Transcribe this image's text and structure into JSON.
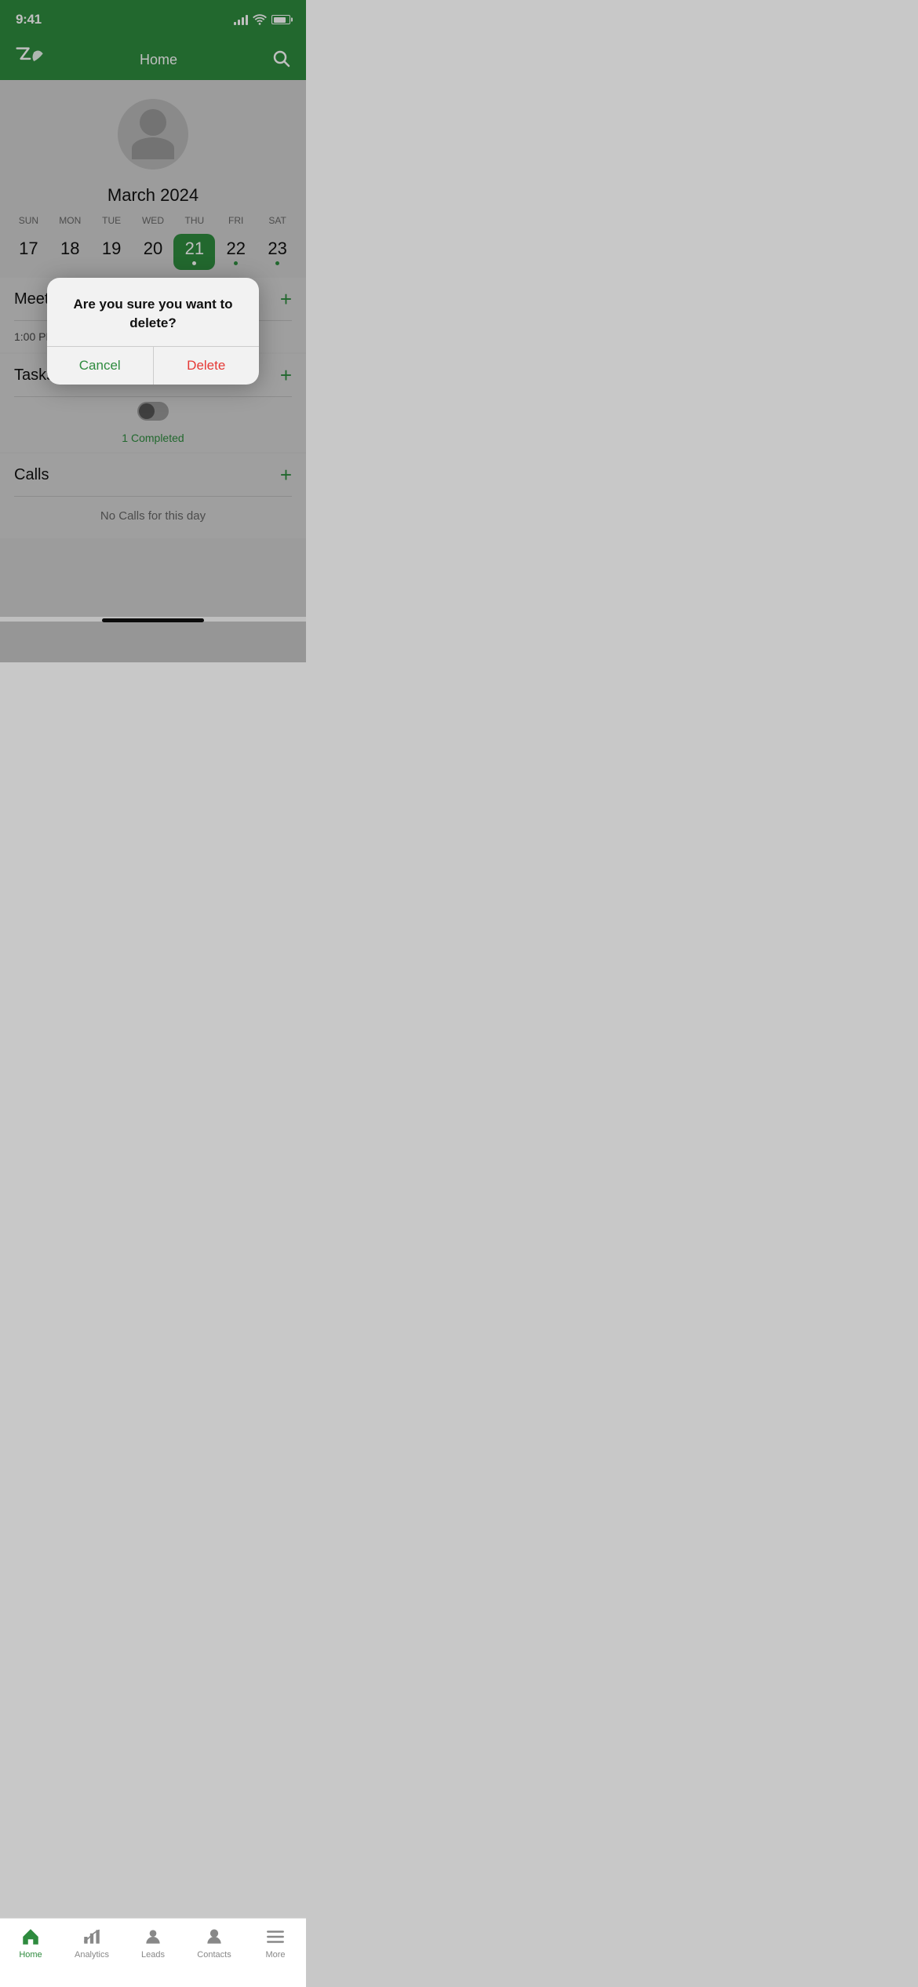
{
  "statusBar": {
    "time": "9:41"
  },
  "navBar": {
    "title": "Home",
    "logoText": "Z∧",
    "searchLabel": "search"
  },
  "profile": {
    "avatarAlt": "User Avatar"
  },
  "calendar": {
    "monthYear": "March 2024",
    "weekdays": [
      "SUN",
      "MON",
      "TUE",
      "WED",
      "THU",
      "FRI",
      "SAT"
    ],
    "days": [
      {
        "date": 17,
        "hasEvent": false,
        "today": false
      },
      {
        "date": 18,
        "hasEvent": false,
        "today": false
      },
      {
        "date": 19,
        "hasEvent": false,
        "today": false
      },
      {
        "date": 20,
        "hasEvent": false,
        "today": false
      },
      {
        "date": 21,
        "hasEvent": true,
        "today": true
      },
      {
        "date": 22,
        "hasEvent": true,
        "today": false
      },
      {
        "date": 23,
        "hasEvent": true,
        "today": false
      }
    ]
  },
  "meetings": {
    "title": "Meetings",
    "addLabel": "+",
    "item": {
      "time": "1:00 PM"
    }
  },
  "tasks": {
    "title": "Tasks",
    "addLabel": "+",
    "completedText": "1 Completed"
  },
  "calls": {
    "title": "Calls",
    "addLabel": "+",
    "emptyText": "No Calls for this day"
  },
  "modal": {
    "message": "Are you sure you want to delete?",
    "cancelLabel": "Cancel",
    "deleteLabel": "Delete"
  },
  "tabBar": {
    "items": [
      {
        "id": "home",
        "label": "Home",
        "active": true
      },
      {
        "id": "analytics",
        "label": "Analytics",
        "active": false
      },
      {
        "id": "leads",
        "label": "Leads",
        "active": false
      },
      {
        "id": "contacts",
        "label": "Contacts",
        "active": false
      },
      {
        "id": "more",
        "label": "More",
        "active": false
      }
    ]
  },
  "homeBar": {
    "label": "home-indicator"
  }
}
